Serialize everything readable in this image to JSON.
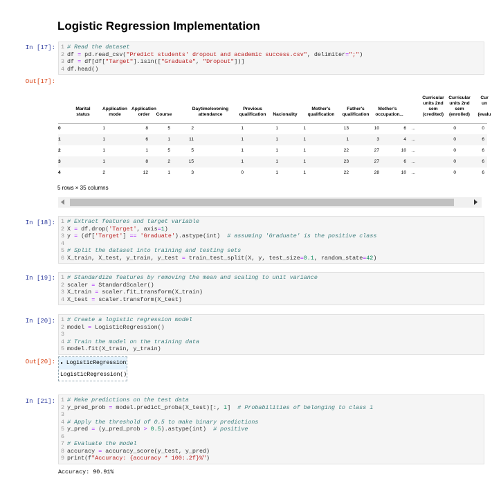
{
  "title": "Logistic Regression Implementation",
  "cells": [
    {
      "prompt": "In [17]:",
      "lines": [
        "# Read the dataset",
        "df = pd.read_csv(\"Predict students' dropout and academic success.csv\", delimiter=\";\")",
        "df = df[df[\"Target\"].isin([\"Graduate\", \"Dropout\"])]",
        "df.head()"
      ]
    },
    {
      "prompt": "In [18]:",
      "lines": [
        "# Extract features and target variable",
        "X = df.drop('Target', axis=1)",
        "y = (df['Target'] == 'Graduate').astype(int)  # assuming 'Graduate' is the positive class",
        "",
        "# Split the dataset into training and testing sets",
        "X_train, X_test, y_train, y_test = train_test_split(X, y, test_size=0.1, random_state=42)"
      ]
    },
    {
      "prompt": "In [19]:",
      "lines": [
        "# Standardize features by removing the mean and scaling to unit variance",
        "scaler = StandardScaler()",
        "X_train = scaler.fit_transform(X_train)",
        "X_test = scaler.transform(X_test)"
      ]
    },
    {
      "prompt": "In [20]:",
      "lines": [
        "# Create a logistic regression model",
        "model = LogisticRegression()",
        "",
        "# Train the model on the training data",
        "model.fit(X_train, y_train)"
      ]
    },
    {
      "prompt": "In [21]:",
      "lines": [
        "# Make predictions on the test data",
        "y_pred_prob = model.predict_proba(X_test)[:, 1]  # Probabilities of belonging to class 1",
        "",
        "# Apply the threshold of 0.5 to make binary predictions",
        "y_pred = (y_pred_prob > 0.5).astype(int)  # positive",
        "",
        "# Evaluate the model",
        "accuracy = accuracy_score(y_test, y_pred)",
        "print(f\"Accuracy: {accuracy * 100:.2f}%\")"
      ]
    }
  ],
  "out17_prompt": "Out[17]:",
  "out20_prompt": "Out[20]:",
  "dataframe": {
    "columns": [
      [
        "Marital",
        "status"
      ],
      [
        "Application",
        "mode"
      ],
      [
        "Application",
        "order"
      ],
      [
        "Course"
      ],
      [
        "Daytime/evening",
        "attendance"
      ],
      [
        "Previous",
        "qualification"
      ],
      [
        "Nacionality"
      ],
      [
        "Mother's",
        "qualification"
      ],
      [
        "Father's",
        "qualification"
      ],
      [
        "Mother's",
        "occupation"
      ],
      [
        "..."
      ],
      [
        "Curricular",
        "units 2nd",
        "sem",
        "(credited)"
      ],
      [
        "Curricular",
        "units 2nd",
        "sem",
        "(enrolled)"
      ],
      [
        "Cur",
        "un",
        "",
        "(evalu"
      ]
    ],
    "rows": [
      [
        "0",
        "1",
        "8",
        "5",
        "2",
        "1",
        "1",
        "1",
        "13",
        "10",
        "6",
        "...",
        "0",
        "0"
      ],
      [
        "1",
        "1",
        "6",
        "1",
        "11",
        "1",
        "1",
        "1",
        "1",
        "3",
        "4",
        "...",
        "0",
        "6"
      ],
      [
        "2",
        "1",
        "1",
        "5",
        "5",
        "1",
        "1",
        "1",
        "22",
        "27",
        "10",
        "...",
        "0",
        "6"
      ],
      [
        "3",
        "1",
        "8",
        "2",
        "15",
        "1",
        "1",
        "1",
        "23",
        "27",
        "6",
        "...",
        "0",
        "6"
      ],
      [
        "4",
        "2",
        "12",
        "1",
        "3",
        "0",
        "1",
        "1",
        "22",
        "28",
        "10",
        "...",
        "0",
        "6"
      ]
    ],
    "shape": "5 rows × 35 columns"
  },
  "model_output": {
    "toggle_label": "LogisticRegression",
    "repr": "LogisticRegression()"
  },
  "accuracy_output": "Accuracy: 90.91%"
}
